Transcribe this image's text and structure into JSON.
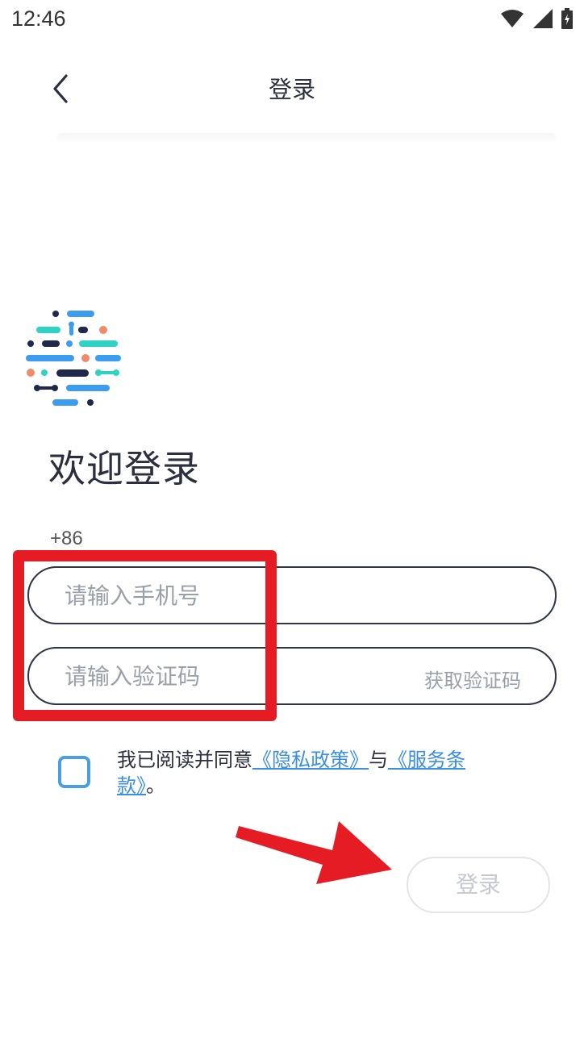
{
  "status_bar": {
    "time": "12:46"
  },
  "header": {
    "title": "登录"
  },
  "welcome": "欢迎登录",
  "country_code": "+86",
  "phone_input": {
    "placeholder": "请输入手机号",
    "value": ""
  },
  "code_input": {
    "placeholder": "请输入验证码",
    "value": ""
  },
  "get_code_label": "获取验证码",
  "agreement": {
    "checked": false,
    "prefix": "我已阅读并同意",
    "privacy_link": "《隐私政策》",
    "connector": "与",
    "terms_link": "《服务条款》",
    "suffix": "。"
  },
  "login_button": "登录",
  "colors": {
    "annotation_red": "#e51c24",
    "link_blue": "#3a8ee6",
    "field_border": "#2f3446",
    "disabled_text": "#c5c8ce"
  },
  "icons": [
    "wifi-icon",
    "cellular-signal-icon",
    "battery-icon",
    "back-arrow-icon",
    "app-logo-icon"
  ]
}
